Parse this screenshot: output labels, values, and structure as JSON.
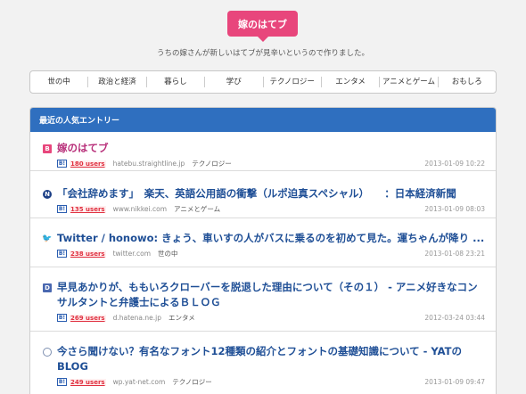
{
  "site": {
    "logo": "嫁のはてブ",
    "tagline": "うちの嫁さんが新しいはてブが見辛いというので作りました。"
  },
  "nav": [
    "世の中",
    "政治と経済",
    "暮らし",
    "学び",
    "テクノロジー",
    "エンタメ",
    "アニメとゲーム",
    "おもしろ"
  ],
  "panel": {
    "header": "最近の人気エントリー"
  },
  "entries": [
    {
      "title": "嫁のはてブ",
      "favicon": "hatebu-icon",
      "users": "180 users",
      "domain": "hatebu.straightline.jp",
      "category": "テクノロジー",
      "date": "2013-01-09 10:22"
    },
    {
      "title": "「会社辞めます」　楽天、英語公用語の衝撃（ルポ迫真スペシャル）　　：日本経済新聞",
      "favicon": "nikkei-icon",
      "users": "135 users",
      "domain": "www.nikkei.com",
      "category": "アニメとゲーム",
      "date": "2013-01-09 08:03"
    },
    {
      "title": "Twitter / honowo: きょう、車いすの人がバスに乗るのを初めて見た。運ちゃんが降り ...",
      "favicon": "twitter-icon",
      "users": "238 users",
      "domain": "twitter.com",
      "category": "世の中",
      "date": "2013-01-08 23:21"
    },
    {
      "title": "早見あかりが、ももいろクローバーを脱退した理由について（その１） - アニメ好きなコンサルタントと弁護士によるＢＬＯＧ",
      "favicon": "dhatena-icon",
      "users": "269 users",
      "domain": "d.hatena.ne.jp",
      "category": "エンタメ",
      "date": "2012-03-24 03:44"
    },
    {
      "title": "今さら聞けない？有名なフォント12種類の紹介とフォントの基礎知識について - YATのBLOG",
      "favicon": "globe-icon",
      "users": "249 users",
      "domain": "wp.yat-net.com",
      "category": "テクノロジー",
      "date": "2013-01-09 09:47"
    }
  ],
  "colors": {
    "brand_pink": "#e8467c",
    "header_blue": "#2f6fbf",
    "link_blue": "#1f4f96",
    "users_red": "#e03040"
  }
}
